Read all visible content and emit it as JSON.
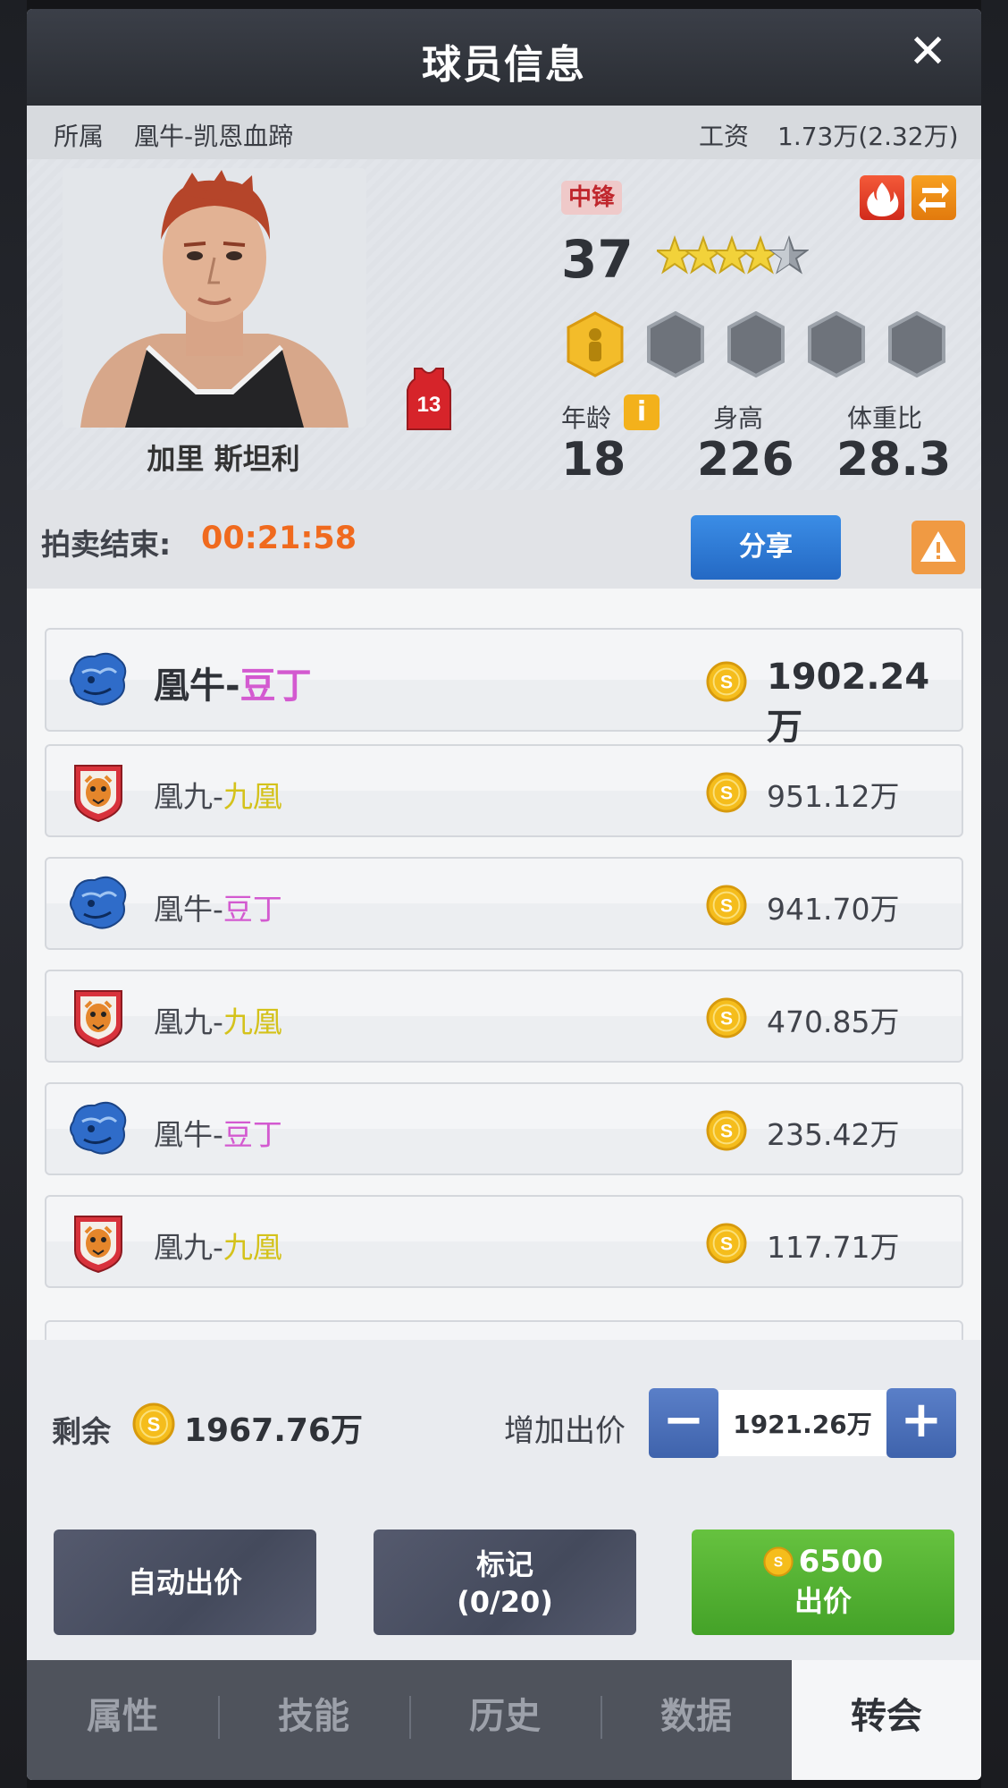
{
  "header": {
    "title": "球员信息",
    "close_symbol": "✕"
  },
  "info_bar": {
    "club_label": "所属",
    "club_name": "凰牛-凯恩血蹄",
    "salary_label": "工资",
    "salary_value": "1.73万(2.32万)"
  },
  "player": {
    "name": "加里 斯坦利",
    "jersey_number": "13",
    "position": "中锋",
    "rating": "37",
    "stars": 4.5,
    "age_label": "年龄",
    "age": "18",
    "height_label": "身高",
    "height": "226",
    "weight_ratio_label": "体重比",
    "weight_ratio": "28.3",
    "info_symbol": "i"
  },
  "auction": {
    "label": "拍卖结束:",
    "time": "00:21:58",
    "share_label": "分享"
  },
  "bids": [
    {
      "team": "bull",
      "prefix": "凰牛-",
      "suffix": "豆丁",
      "suffix_color": "pink",
      "amount": "1902.24万",
      "top": true
    },
    {
      "team": "nine",
      "prefix": "凰九-",
      "suffix": "九凰",
      "suffix_color": "yellow",
      "amount": "951.12万",
      "top": false
    },
    {
      "team": "bull",
      "prefix": "凰牛-",
      "suffix": "豆丁",
      "suffix_color": "pink",
      "amount": "941.70万",
      "top": false
    },
    {
      "team": "nine",
      "prefix": "凰九-",
      "suffix": "九凰",
      "suffix_color": "yellow",
      "amount": "470.85万",
      "top": false
    },
    {
      "team": "bull",
      "prefix": "凰牛-",
      "suffix": "豆丁",
      "suffix_color": "pink",
      "amount": "235.42万",
      "top": false
    },
    {
      "team": "nine",
      "prefix": "凰九-",
      "suffix": "九凰",
      "suffix_color": "yellow",
      "amount": "117.71万",
      "top": false
    }
  ],
  "wallet": {
    "remain_label": "剩余",
    "remain_value": "1967.76万",
    "raise_label": "增加出价",
    "minus_symbol": "−",
    "plus_symbol": "+",
    "bid_value": "1921.26万"
  },
  "actions": {
    "auto_bid": "自动出价",
    "mark_line1": "标记",
    "mark_line2": "(0/20)",
    "bid_cost": "6500",
    "bid_label": "出价"
  },
  "tabs": [
    {
      "label": "属性",
      "active": false
    },
    {
      "label": "技能",
      "active": false
    },
    {
      "label": "历史",
      "active": false
    },
    {
      "label": "数据",
      "active": false
    },
    {
      "label": "转会",
      "active": true
    }
  ],
  "colors": {
    "accent_orange": "#f06a1e",
    "pink_name": "#d35ad0",
    "yellow_name": "#d4c21b",
    "bid_green": "#55b232",
    "share_blue": "#2f7bd6"
  }
}
